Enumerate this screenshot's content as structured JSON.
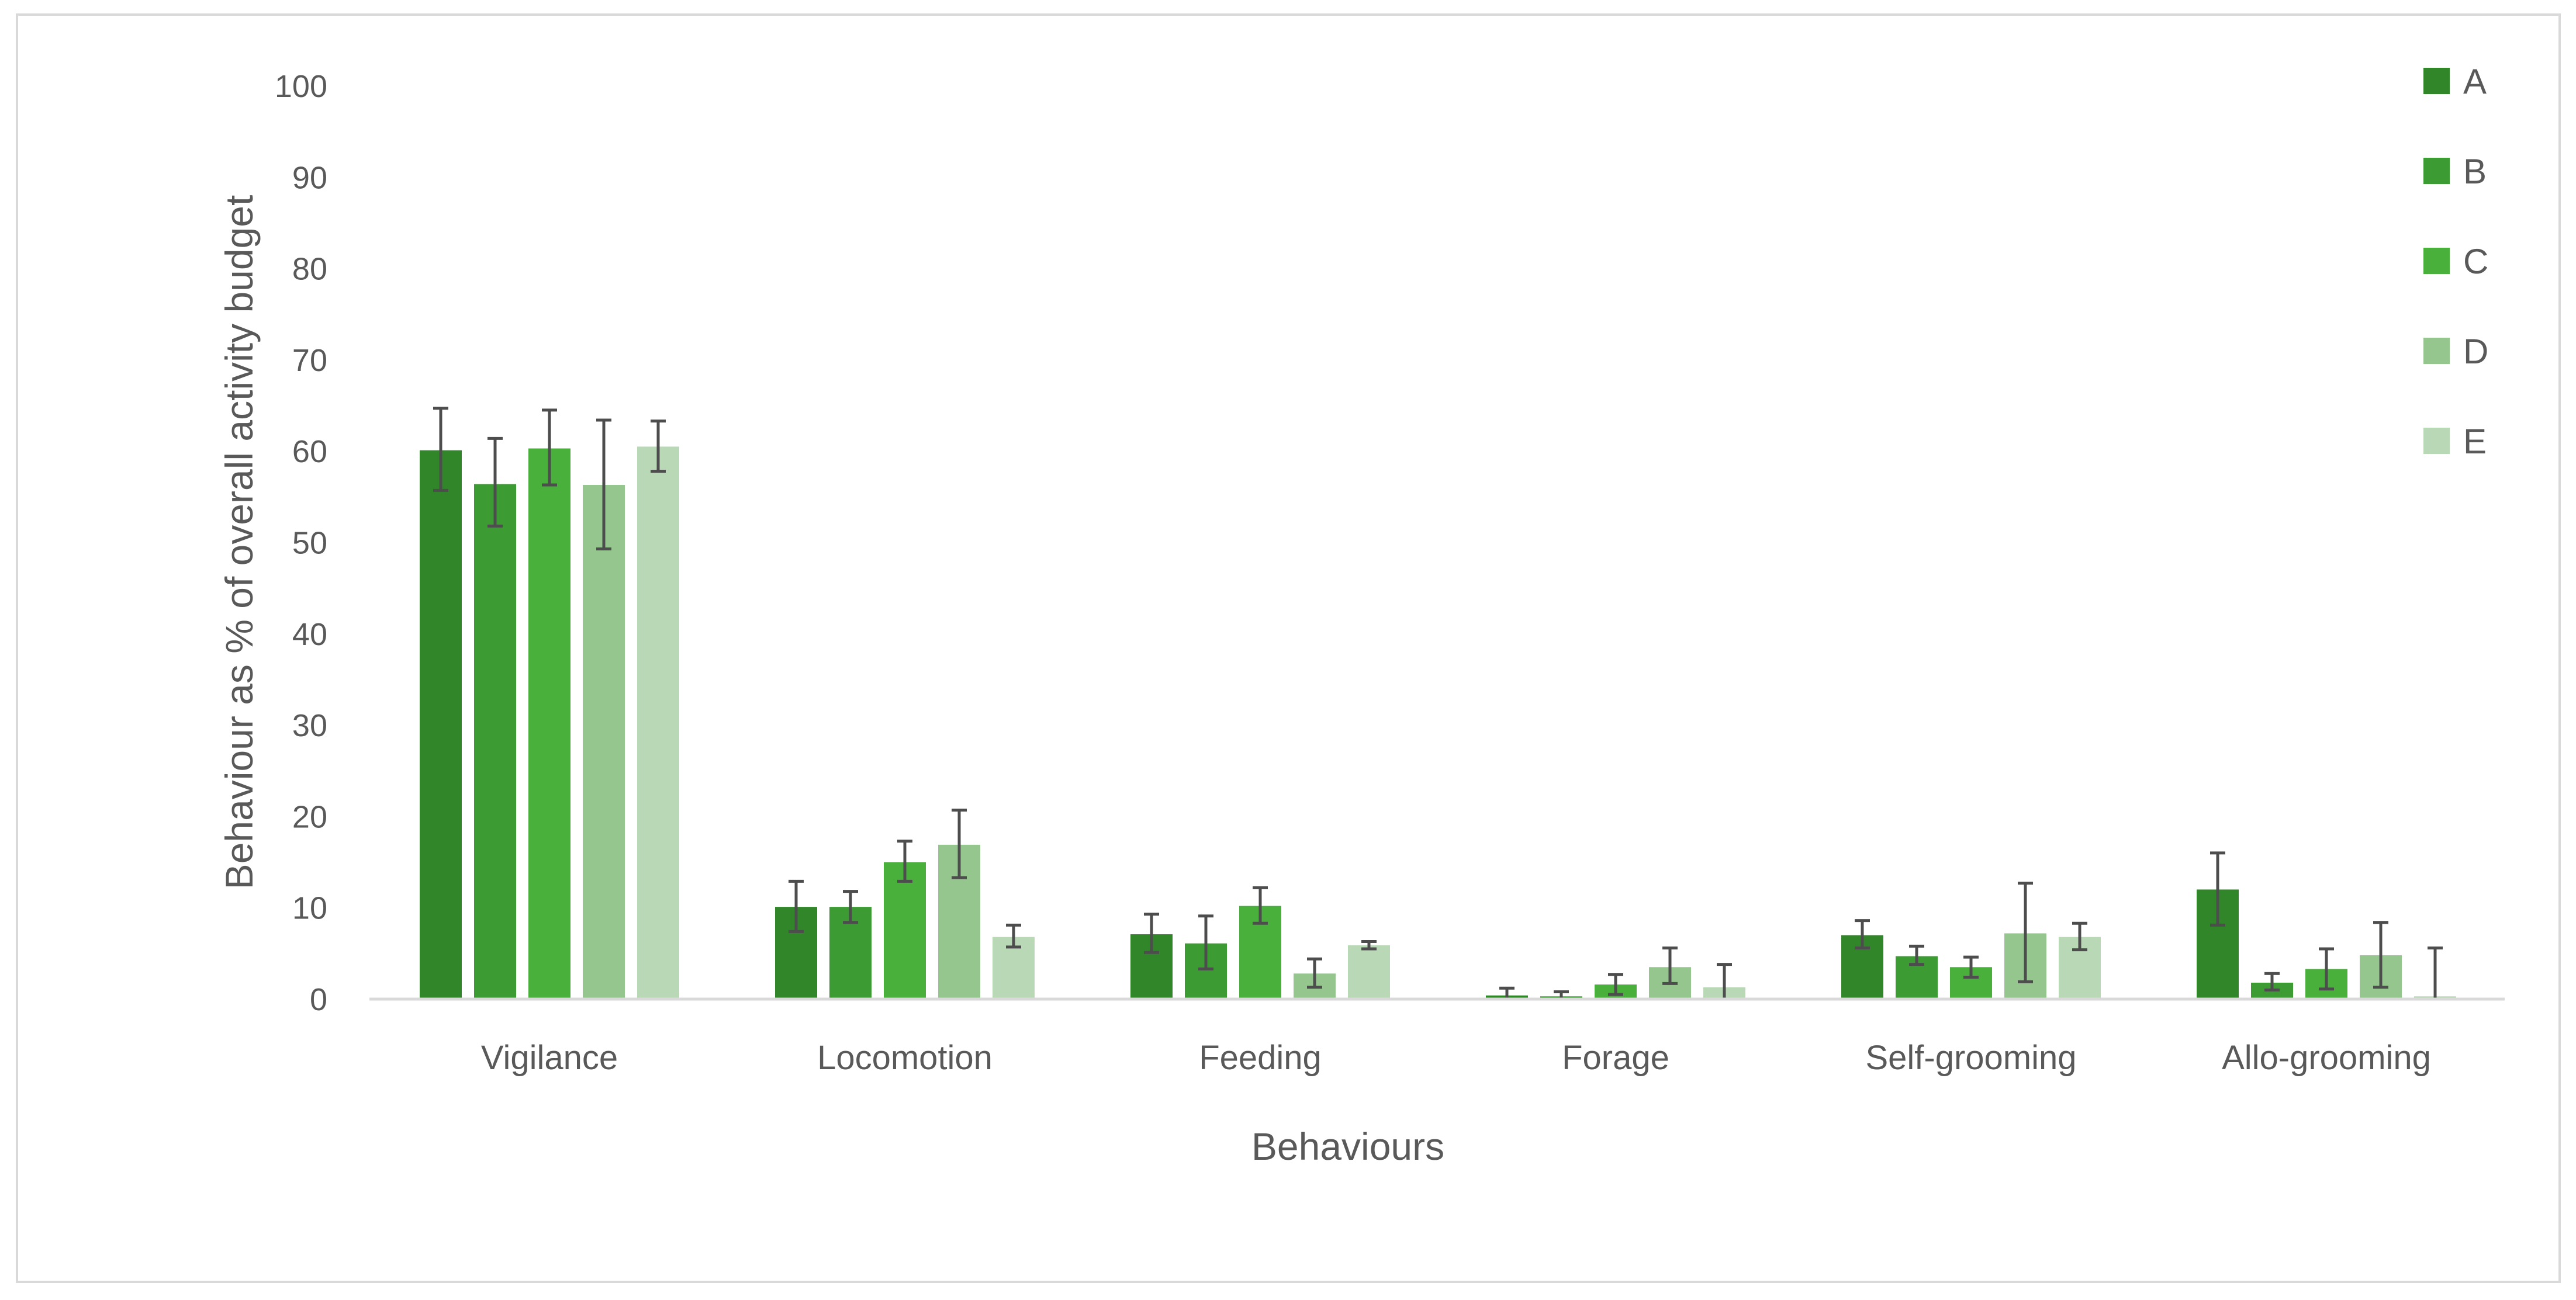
{
  "chart_data": {
    "type": "bar",
    "title": "",
    "xlabel": "Behaviours",
    "ylabel": "Behaviour as % of overall activity budget",
    "ylim": [
      0,
      100
    ],
    "yticks": [
      0,
      10,
      20,
      30,
      40,
      50,
      60,
      70,
      80,
      90,
      100
    ],
    "grid": false,
    "legend_position": "top-right",
    "categories": [
      "Vigilance",
      "Locomotion",
      "Feeding",
      "Forage",
      "Self-grooming",
      "Allo-grooming"
    ],
    "series": [
      {
        "name": "A",
        "color": "#31862a",
        "values": [
          60.1,
          10.1,
          7.1,
          0.4,
          7.0,
          12.0
        ],
        "error_low": [
          55.7,
          7.4,
          5.1,
          0.0,
          5.6,
          8.1
        ],
        "error_high": [
          64.7,
          12.9,
          9.3,
          1.2,
          8.6,
          16.0
        ]
      },
      {
        "name": "B",
        "color": "#3c9b33",
        "values": [
          56.4,
          10.1,
          6.1,
          0.3,
          4.7,
          1.8
        ],
        "error_low": [
          51.8,
          8.4,
          3.3,
          0.0,
          3.8,
          1.0
        ],
        "error_high": [
          61.4,
          11.8,
          9.1,
          0.8,
          5.8,
          2.8
        ]
      },
      {
        "name": "C",
        "color": "#49b03c",
        "values": [
          60.3,
          15.0,
          10.2,
          1.6,
          3.5,
          3.3
        ],
        "error_low": [
          56.3,
          12.9,
          8.3,
          0.5,
          2.4,
          1.1
        ],
        "error_high": [
          64.5,
          17.3,
          12.2,
          2.7,
          4.6,
          5.5
        ]
      },
      {
        "name": "D",
        "color": "#94c68e",
        "values": [
          56.3,
          16.9,
          2.8,
          3.5,
          7.2,
          4.8
        ],
        "error_low": [
          49.3,
          13.3,
          1.3,
          1.7,
          1.9,
          1.3
        ],
        "error_high": [
          63.4,
          20.7,
          4.4,
          5.6,
          12.7,
          8.4
        ]
      },
      {
        "name": "E",
        "color": "#b9d8b5",
        "values": [
          60.5,
          6.8,
          5.9,
          1.3,
          6.8,
          0.3
        ],
        "error_low": [
          57.8,
          5.7,
          5.5,
          0.0,
          5.4,
          0.0
        ],
        "error_high": [
          63.3,
          8.1,
          6.3,
          3.8,
          8.3,
          5.6
        ]
      }
    ],
    "colors": {
      "text": "#595959",
      "axis_line": "#d9d9d9",
      "error_bar": "#4d4d4d",
      "frame": "#d9d9d9"
    }
  }
}
